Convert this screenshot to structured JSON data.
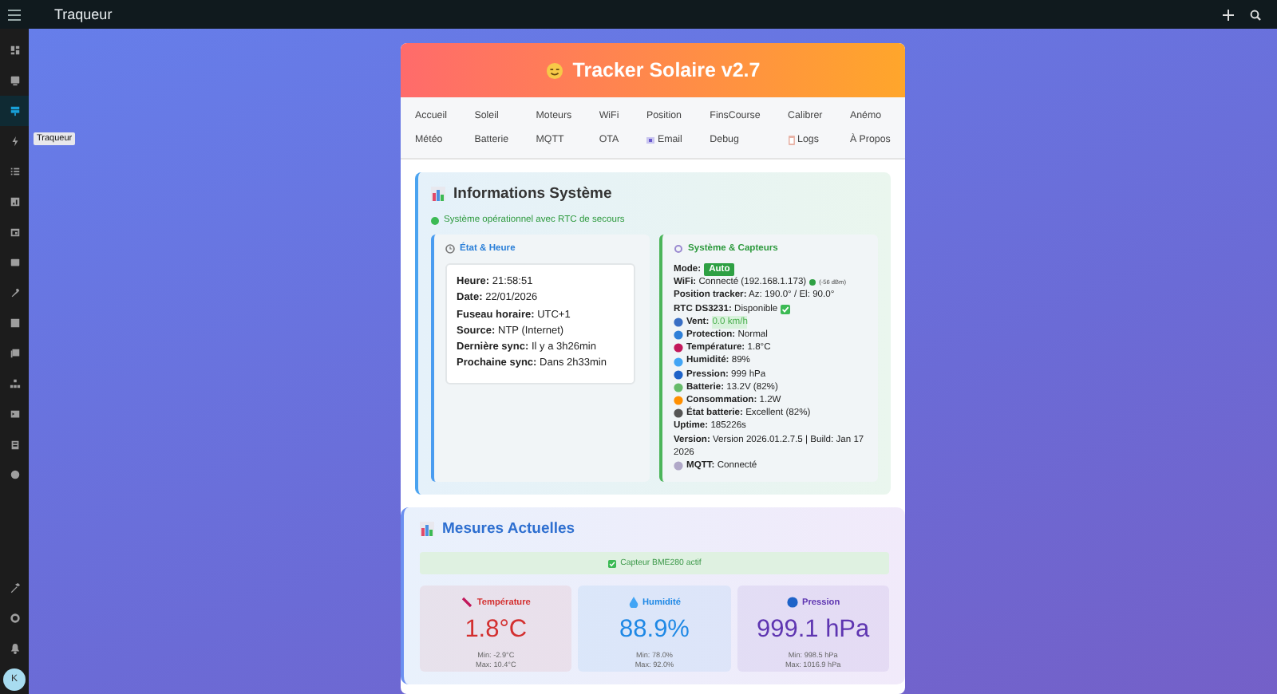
{
  "top_bar": {
    "title": "Traqueur"
  },
  "sidebar": {
    "items": [
      {
        "selected": false
      },
      {
        "selected": false
      },
      {
        "selected": true
      },
      {
        "selected": false
      },
      {
        "selected": false
      },
      {
        "selected": false
      },
      {
        "selected": false
      },
      {
        "selected": false
      },
      {
        "selected": false
      },
      {
        "selected": false
      },
      {
        "selected": false
      },
      {
        "selected": false
      },
      {
        "selected": false
      },
      {
        "selected": false
      },
      {
        "selected": false
      }
    ],
    "tooltip": "Traqueur",
    "avatar": "K"
  },
  "card": {
    "title": "Tracker Solaire v2.7",
    "nav": [
      {
        "label": "Accueil",
        "kind": "text"
      },
      {
        "label": "Soleil",
        "kind": "text"
      },
      {
        "label": "Moteurs",
        "kind": "text"
      },
      {
        "label": "WiFi",
        "kind": "text"
      },
      {
        "label": "Position",
        "kind": "text"
      },
      {
        "label": "FinsCourse",
        "kind": "text"
      },
      {
        "label": "Calibrer",
        "kind": "text"
      },
      {
        "label": "Anémo",
        "kind": "text"
      },
      {
        "label": "Météo",
        "kind": "text"
      },
      {
        "label": "Batterie",
        "kind": "text"
      },
      {
        "label": "MQTT",
        "kind": "text"
      },
      {
        "label": "OTA",
        "kind": "text"
      },
      {
        "label": "Email",
        "kind": "email"
      },
      {
        "label": "Debug",
        "kind": "text"
      },
      {
        "label": "Logs",
        "kind": "logs"
      },
      {
        "label": "À Propos",
        "kind": "text"
      }
    ]
  },
  "info": {
    "title": "Informations Système",
    "status": "Système opérationnel avec RTC de secours",
    "time_panel": {
      "title": "État & Heure",
      "fields": [
        {
          "label": "Heure:",
          "value": "21:58:51"
        },
        {
          "label": "Date:",
          "value": "22/01/2026"
        },
        {
          "label": "Fuseau horaire:",
          "value": "UTC+1"
        },
        {
          "label": "Source:",
          "value": "NTP (Internet)"
        },
        {
          "label": "Dernière sync:",
          "value": "Il y a 3h26min"
        },
        {
          "label": "Prochaine sync:",
          "value": "Dans 2h33min"
        }
      ]
    },
    "system_panel": {
      "title": "Système & Capteurs",
      "rows": [
        {
          "kind": "badge",
          "label": "Mode:",
          "value": "Auto"
        },
        {
          "kind": "wifi",
          "label": "WiFi:",
          "value": "Connecté (192.168.1.173)",
          "note": "(-56 dBm)"
        },
        {
          "kind": "plain",
          "label": "Position tracker:",
          "value": "Az: 190.0° / El: 90.0°"
        },
        {
          "kind": "check",
          "label": "RTC DS3231:",
          "value": "Disponible"
        },
        {
          "kind": "highlight",
          "label": "Vent:",
          "value": "0.0 km/h",
          "color": "#3a6fc4"
        },
        {
          "kind": "icon",
          "label": "Protection:",
          "value": "Normal",
          "color": "#2f80d8"
        },
        {
          "kind": "icon",
          "label": "Température:",
          "value": "1.8°C",
          "color": "#c2185b"
        },
        {
          "kind": "icon",
          "label": "Humidité:",
          "value": "89%",
          "color": "#42a5f5"
        },
        {
          "kind": "icon",
          "label": "Pression:",
          "value": "999 hPa",
          "color": "#1e63c8"
        },
        {
          "kind": "icon",
          "label": "Batterie:",
          "value": "13.2V (82%)",
          "color": "#66bb6a"
        },
        {
          "kind": "icon",
          "label": "Consommation:",
          "value": "1.2W",
          "color": "#ff8f00"
        },
        {
          "kind": "icon",
          "label": "État batterie:",
          "value": "Excellent (82%)",
          "color": "#555555"
        },
        {
          "kind": "plain",
          "label": "Uptime:",
          "value": "185226s"
        },
        {
          "kind": "plain",
          "label": "Version:",
          "value": "Version 2026.01.2.7.5 | Build: Jan 17 2026"
        },
        {
          "kind": "icon",
          "label": "MQTT:",
          "value": "Connecté",
          "color": "#b0a8c8"
        }
      ]
    }
  },
  "measures": {
    "title": "Mesures Actuelles",
    "banner": "Capteur BME280 actif",
    "cards": [
      {
        "label": "Température",
        "value": "1.8°C",
        "min": "Min: -2.9°C",
        "max": "Max: 10.4°C",
        "color": "#d32f2f"
      },
      {
        "label": "Humidité",
        "value": "88.9%",
        "min": "Min: 78.0%",
        "max": "Max: 92.0%",
        "color": "#1e88e5"
      },
      {
        "label": "Pression",
        "value": "999.1 hPa",
        "min": "Min: 998.5 hPa",
        "max": "Max: 1016.9 hPa",
        "color": "#5e35b1"
      }
    ]
  }
}
